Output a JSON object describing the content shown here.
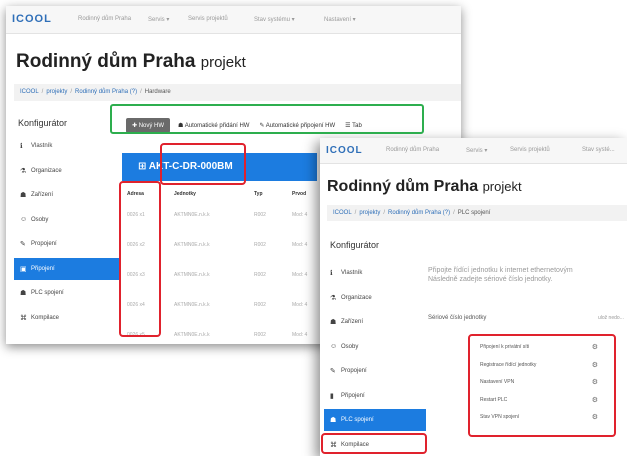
{
  "app": {
    "logo": "ICOOL",
    "nav": [
      "Rodinný dům Praha",
      "Servis ▾",
      "Servis projektů",
      "Stav systému ▾",
      "Nastavení ▾"
    ],
    "project_title": "Rodinný dům Praha",
    "project_suffix": "projekt"
  },
  "window1": {
    "breadcrumb": {
      "home": "ICOOL",
      "projects": "projekty",
      "project": "Rodinný dům Praha (?)",
      "current": "Hardware"
    },
    "panel_title": "Konfigurátor",
    "sidebar": [
      {
        "label": "Vlastník",
        "icon": "ℹ",
        "icon_name": "info-icon"
      },
      {
        "label": "Organizace",
        "icon": "⚗",
        "icon_name": "organization-icon"
      },
      {
        "label": "Zařízení",
        "icon": "☗",
        "icon_name": "devices-icon"
      },
      {
        "label": "Osoby",
        "icon": "☺",
        "icon_name": "people-icon"
      },
      {
        "label": "Propojení",
        "icon": "✎",
        "icon_name": "wrench-icon"
      },
      {
        "label": "Připojení",
        "icon": "▣",
        "icon_name": "connect-icon",
        "active": true
      },
      {
        "label": "PLC spojení",
        "icon": "☗",
        "icon_name": "plc-icon"
      },
      {
        "label": "Kompilace",
        "icon": "⌘",
        "icon_name": "compile-icon"
      }
    ],
    "toolbar": {
      "new_button": "✚ Nový HW",
      "auto_add": "☗ Automatické přidání HW",
      "auto_connect": "✎ Automatické připojení HW",
      "more": "☰ Tab"
    },
    "device_name": "⊞ AKT-C-DR-000BM",
    "table": {
      "headers": [
        "Adresa",
        "Jednotky",
        "Typ",
        "Prvod"
      ],
      "rows": [
        [
          "0026 x1",
          "AKTMN0E.n.k.k",
          "R002",
          "Mod: 4"
        ],
        [
          "0026 x2",
          "AKTMN0E.n.k.k",
          "R002",
          "Mod: 4"
        ],
        [
          "0026 x3",
          "AKTMN0E.n.k.k",
          "R002",
          "Mod: 4"
        ],
        [
          "0026 x4",
          "AKTMN0E.n.k.k",
          "R002",
          "Mod: 4"
        ],
        [
          "0026 x5",
          "AKTMN0E.n.k.k",
          "R002",
          "Mod: 4"
        ]
      ]
    }
  },
  "window2": {
    "nav": [
      "Rodinný dům Praha",
      "Servis ▾",
      "Servis projektů",
      "Stav systé..."
    ],
    "breadcrumb": {
      "home": "ICOOL",
      "projects": "projekty",
      "project": "Rodinný dům Praha (?)",
      "current": "PLC spojení"
    },
    "panel_title": "Konfigurátor",
    "sidebar": [
      {
        "label": "Vlastník",
        "icon": "ℹ",
        "icon_name": "info-icon"
      },
      {
        "label": "Organizace",
        "icon": "⚗",
        "icon_name": "organization-icon"
      },
      {
        "label": "Zařízení",
        "icon": "☗",
        "icon_name": "devices-icon"
      },
      {
        "label": "Osoby",
        "icon": "☺",
        "icon_name": "people-icon"
      },
      {
        "label": "Propojení",
        "icon": "✎",
        "icon_name": "wrench-icon"
      },
      {
        "label": "Připojení",
        "icon": "▮",
        "icon_name": "connect-icon"
      },
      {
        "label": "PLC spojení",
        "icon": "☗",
        "icon_name": "plc-icon",
        "active": true
      },
      {
        "label": "Kompilace",
        "icon": "⌘",
        "icon_name": "compile-icon"
      }
    ],
    "intro_line1": "Připojte řídící jednotku k internet ethernetovým",
    "intro_line2": "Následně zadejte sériové číslo jednotky.",
    "serial_label": "Sériové číslo jednotky",
    "serial_value": "ulož nedo...",
    "menu": [
      {
        "label": "Připojení k privátní síti",
        "icon": "⚙"
      },
      {
        "label": "Registrace řídící jednotky",
        "icon": "⚙"
      },
      {
        "label": "Nastavení VPN",
        "icon": "⚙"
      },
      {
        "label": "Restart PLC",
        "icon": "⚙"
      },
      {
        "label": "Stav VPN spojení",
        "icon": "⚙"
      }
    ]
  },
  "colors": {
    "accent_blue": "#1c7ce0",
    "link_blue": "#2f6fb8",
    "highlight_green": "#2dae4e",
    "highlight_red": "#e0222d"
  }
}
